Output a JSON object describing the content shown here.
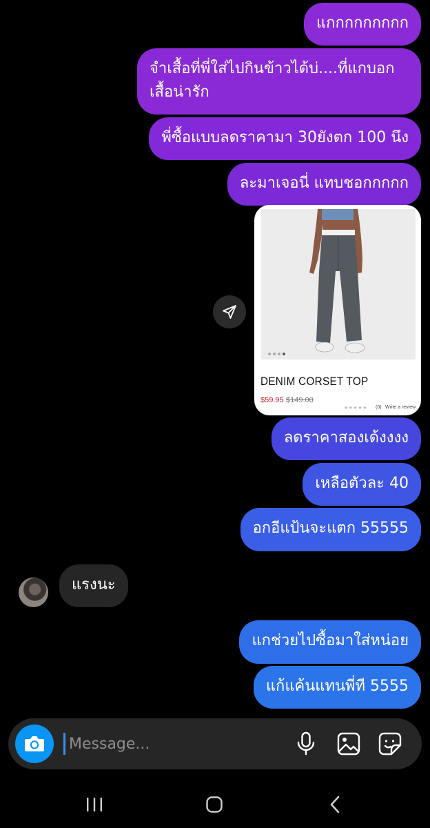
{
  "messages": [
    {
      "text": "แกกกกกกกกก",
      "color": "#8b2bd8"
    },
    {
      "text": "จำเสื้อที่พี่ใส่ไปกินข้าวได้บ่....ที่แกบอกเสื้อน่ารัก",
      "color": "#8a2ad6"
    },
    {
      "text": "พี่ซื้อแบบลดราคามา 30ยังตก 100 นึง",
      "color": "#8429d9"
    },
    {
      "text": "ละมาเจอนี่ แทบชอกกกกก",
      "color": "#7c2ad8"
    },
    {
      "text": "ลดราคาสองเด้งงงง",
      "color": "#4747e0"
    },
    {
      "text": "เหลือตัวละ 40",
      "color": "#3f55e3"
    },
    {
      "text": "อกอีแป้นจะแตก 55555",
      "color": "#3a5ee6"
    },
    {
      "text": "แรงนะ",
      "color": "#262626"
    },
    {
      "text": "แกช่วยไปซื้อมาใส่หน่อย",
      "color": "#2f6ee9"
    },
    {
      "text": "แก้แค้นแทนพี่ที 5555",
      "color": "#2c74ea"
    }
  ],
  "product": {
    "title": "DENIM CORSET TOP",
    "sale_price": "$59.95",
    "original_price": "$149.00",
    "stars": "★★★★★",
    "review_count": "(0)",
    "review_link": "Write a review",
    "image_slide": 4,
    "image_slides_total": 4
  },
  "composer": {
    "placeholder": "Message..."
  },
  "icons": {
    "share": "send-arrow-icon",
    "camera": "camera-icon",
    "mic": "microphone-icon",
    "gallery": "image-icon",
    "sticker": "sticker-icon",
    "nav_recents": "recents-icon",
    "nav_home": "home-icon",
    "nav_back": "back-icon"
  },
  "colors": {
    "accent_camera": "#0a95f5",
    "received_bubble": "#262626"
  }
}
